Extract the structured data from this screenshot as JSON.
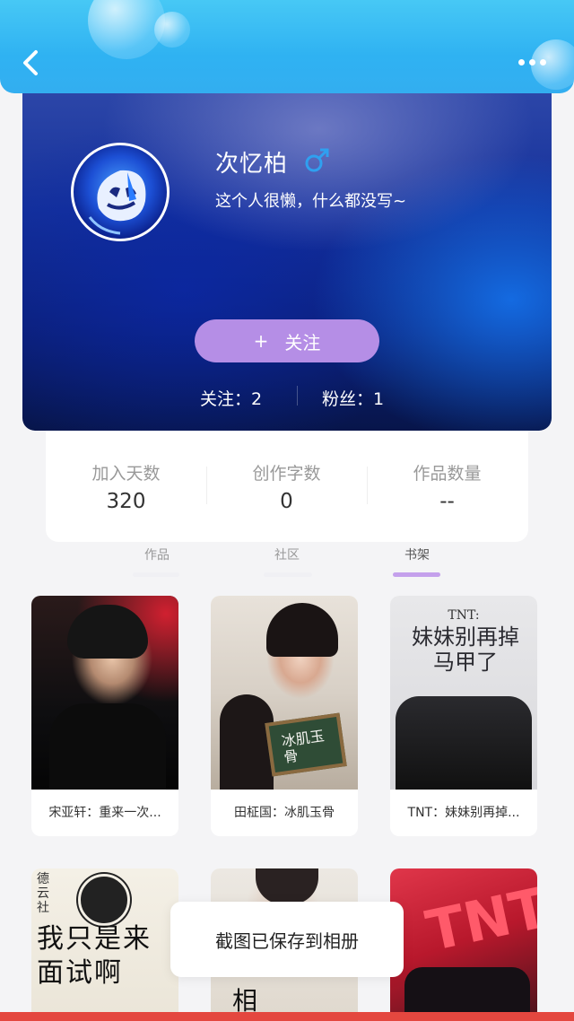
{
  "header": {
    "back_icon": "chevron-left-icon",
    "more_icon": "more-horizontal-icon"
  },
  "profile": {
    "nickname": "次忆柏",
    "gender_icon": "male-icon",
    "gender_color": "#2fa0f0",
    "bio": "这个人很懒，什么都没写~",
    "follow_plus": "+",
    "follow_label": "关注",
    "following_text": "关注：2",
    "followers_text": "粉丝：1"
  },
  "stats": [
    {
      "label": "加入天数",
      "value": "320"
    },
    {
      "label": "创作字数",
      "value": "0"
    },
    {
      "label": "作品数量",
      "value": "--"
    }
  ],
  "tabs": [
    {
      "label": "作品",
      "active": false
    },
    {
      "label": "社区",
      "active": false
    },
    {
      "label": "书架",
      "active": true
    }
  ],
  "books": [
    {
      "title": "宋亚轩：重来一次..."
    },
    {
      "title": "田柾国：冰肌玉骨",
      "cover_text": "冰肌玉骨"
    },
    {
      "title": "TNT：妹妹别再掉...",
      "cover_text": "妹妹别再掉马甲了",
      "cover_sub": "TNT:"
    },
    {
      "title": "",
      "cover_text": "我只是来面试啊",
      "cover_sub": "德云社"
    },
    {
      "title": "",
      "cover_text": "相"
    },
    {
      "title": "",
      "cover_text": "TNT"
    }
  ],
  "toast": "截图已保存到相册",
  "colors": {
    "accent": "#b58ee6",
    "header": "#33aef0",
    "tab_indicator": "#c4a0ec"
  }
}
